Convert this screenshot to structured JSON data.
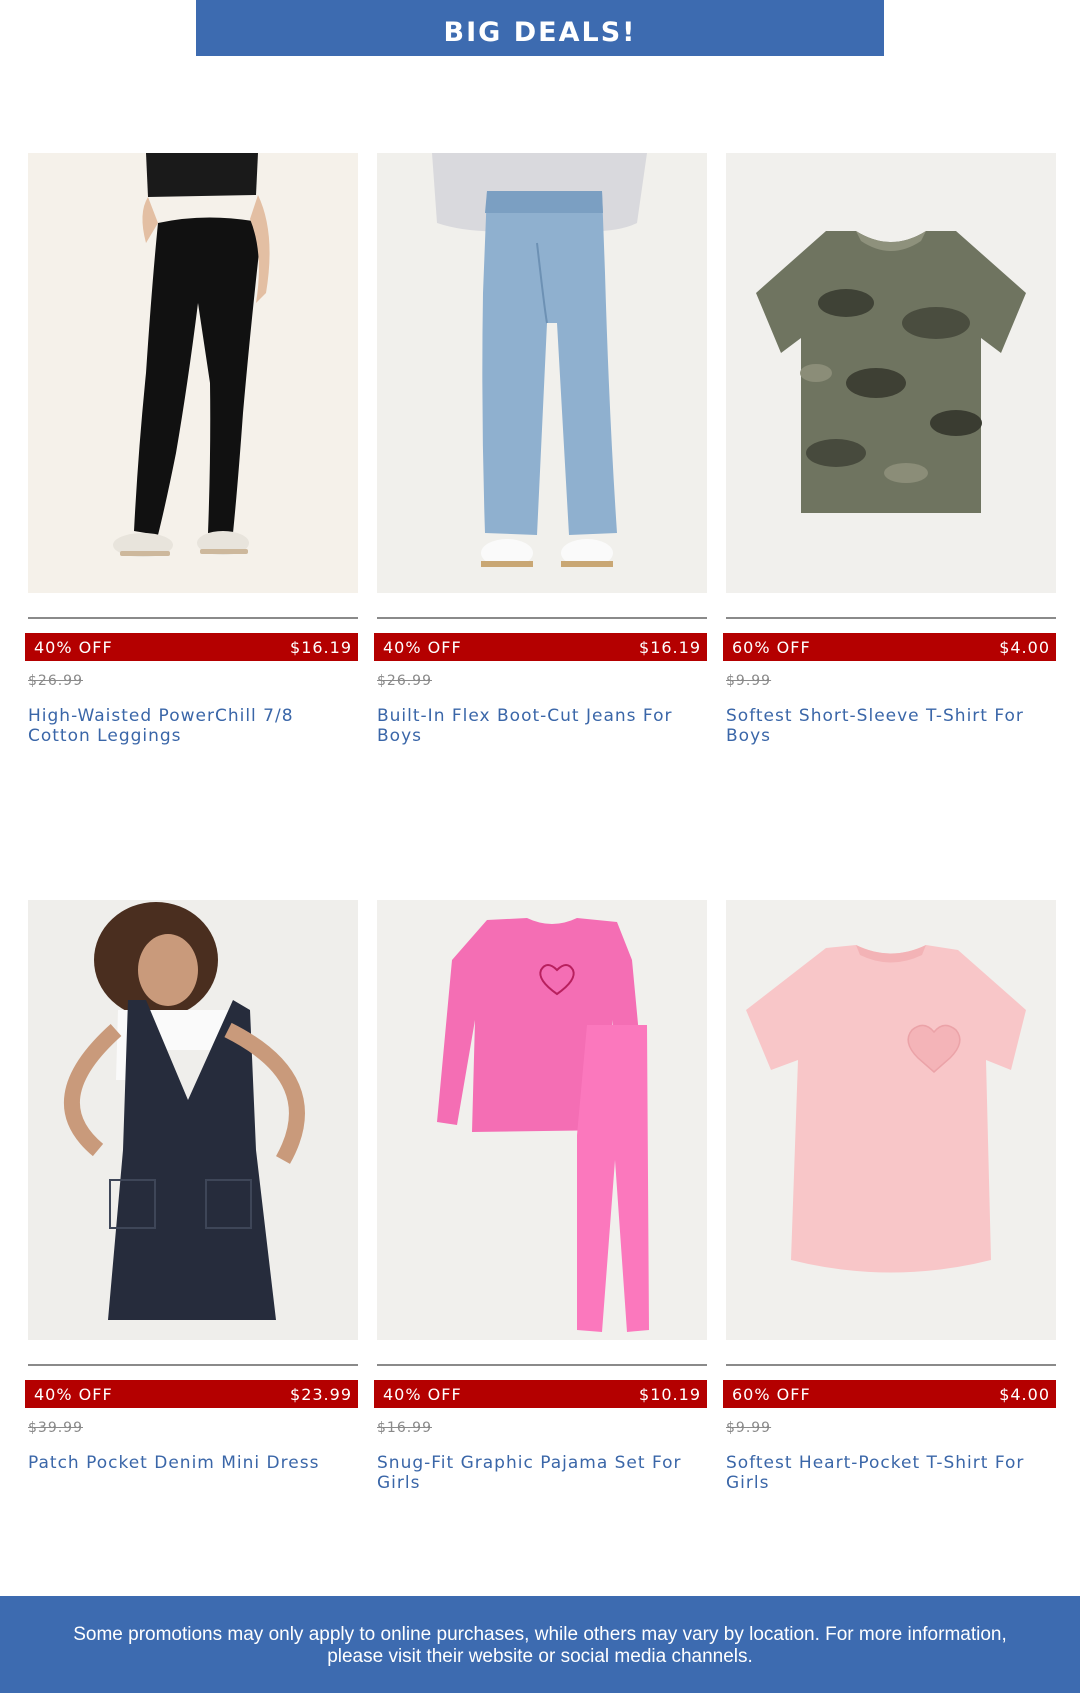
{
  "banner": {
    "title": "BIG DEALS!"
  },
  "products": [
    {
      "discount": "40% OFF",
      "price": "$16.19",
      "original_price": "$26.99",
      "name": "High-Waisted PowerChill 7/8 Cotton Leggings"
    },
    {
      "discount": "40% OFF",
      "price": "$16.19",
      "original_price": "$26.99",
      "name": "Built-In Flex Boot-Cut Jeans For Boys"
    },
    {
      "discount": "60% OFF",
      "price": "$4.00",
      "original_price": "$9.99",
      "name": "Softest Short-Sleeve T-Shirt For Boys"
    },
    {
      "discount": "40% OFF",
      "price": "$23.99",
      "original_price": "$39.99",
      "name": "Patch Pocket Denim Mini Dress"
    },
    {
      "discount": "40% OFF",
      "price": "$10.19",
      "original_price": "$16.99",
      "name": "Snug-Fit Graphic Pajama Set For Girls"
    },
    {
      "discount": "60% OFF",
      "price": "$4.00",
      "original_price": "$9.99",
      "name": "Softest Heart-Pocket T-Shirt For Girls"
    }
  ],
  "footer": {
    "text": "Some promotions may only apply to online purchases, while others may vary by location. For more information, please visit their website or social media channels."
  },
  "colors": {
    "brand_blue": "#3d6bb0",
    "deal_red": "#b40000",
    "link_blue": "#3a66a8",
    "strike_gray": "#8a8a8a"
  }
}
